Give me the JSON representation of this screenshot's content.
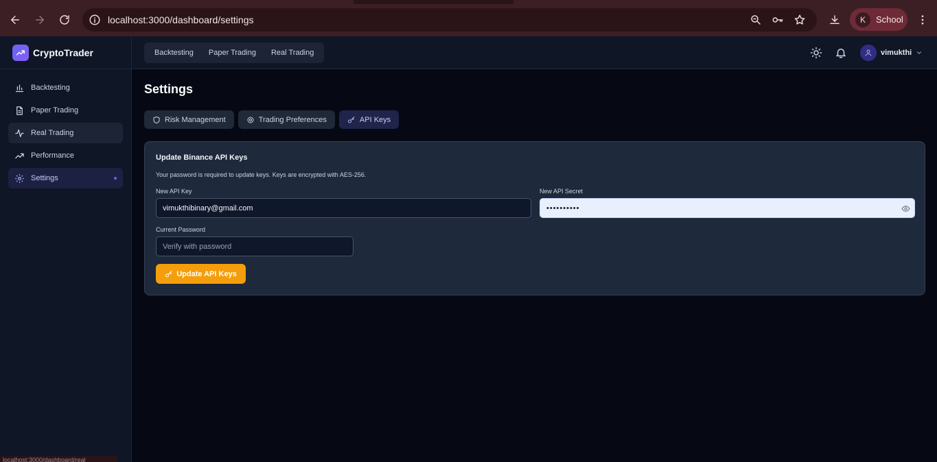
{
  "browser": {
    "url": "localhost:3000/dashboard/settings",
    "profile_initial": "K",
    "profile_name": "School",
    "status_url": "localhost:3000/dashboard/real"
  },
  "sidebar": {
    "brand": "CryptoTrader",
    "items": [
      {
        "label": "Backtesting",
        "icon": "bar-chart-icon"
      },
      {
        "label": "Paper Trading",
        "icon": "document-icon"
      },
      {
        "label": "Real Trading",
        "icon": "activity-icon"
      },
      {
        "label": "Performance",
        "icon": "trending-up-icon"
      },
      {
        "label": "Settings",
        "icon": "gear-icon"
      }
    ]
  },
  "topbar": {
    "nav": [
      "Backtesting",
      "Paper Trading",
      "Real Trading"
    ],
    "username": "vimukthi"
  },
  "main": {
    "title": "Settings",
    "tabs": [
      {
        "label": "Risk Management",
        "icon": "shield-icon"
      },
      {
        "label": "Trading Preferences",
        "icon": "gear-icon"
      },
      {
        "label": "API Keys",
        "icon": "key-icon"
      }
    ],
    "card": {
      "title": "Update Binance API Keys",
      "description": "Your password is required to update keys. Keys are encrypted with AES-256.",
      "api_key_label": "New API Key",
      "api_key_value": "vimukthibinary@gmail.com",
      "api_secret_label": "New API Secret",
      "api_secret_value": "••••••••••",
      "password_label": "Current Password",
      "password_placeholder": "Verify with password",
      "submit_label": "Update API Keys"
    }
  },
  "colors": {
    "accent": "#6366f1",
    "button": "#f59e0b",
    "background": "#060913",
    "panel": "#1e293b"
  }
}
